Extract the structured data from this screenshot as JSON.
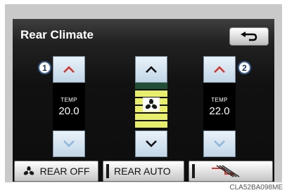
{
  "screen": {
    "title": "Rear Climate"
  },
  "header": {
    "back_icon": "return-arrow-icon"
  },
  "left_zone": {
    "callout": "1",
    "temp_label": "TEMP",
    "temp_value": "20.0"
  },
  "center_zone": {
    "fan_icon": "fan-icon",
    "fan_level_bars": 5
  },
  "right_zone": {
    "callout": "2",
    "temp_label": "TEMP",
    "temp_value": "22.0"
  },
  "bottom": {
    "rear_off_label": "REAR OFF",
    "rear_auto_label": "REAR AUTO",
    "air_flow_icon": "airflow-mode-icon"
  },
  "caption": "CLA52BA098ME",
  "colors": {
    "up_arrow_red": "#d2372f",
    "down_arrow_blue": "#8fb8dc",
    "fan_bar_yellow": "#e9ee6a",
    "fan_bar_green": "#214c36",
    "callout_border": "#3b5f8d"
  }
}
